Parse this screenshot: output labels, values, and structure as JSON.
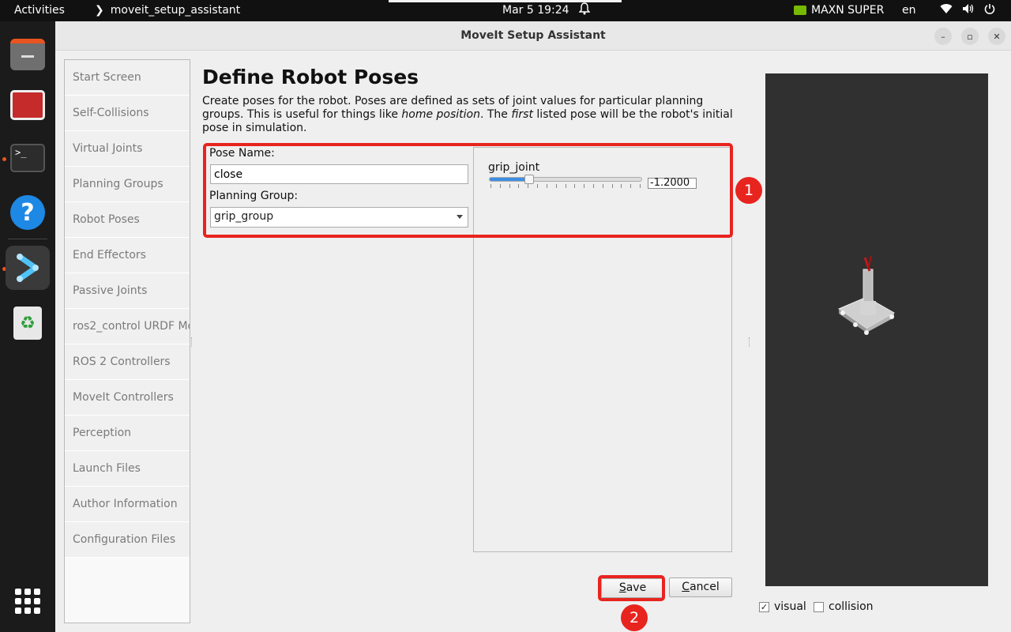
{
  "topbar": {
    "activities": "Activities",
    "app_name": "moveit_setup_assistant",
    "datetime": "Mar 5  19:24",
    "gpu_label": "MAXN SUPER",
    "language": "en"
  },
  "window": {
    "title": "MoveIt Setup Assistant"
  },
  "sidebar": {
    "items": [
      {
        "label": "Start Screen"
      },
      {
        "label": "Self-Collisions"
      },
      {
        "label": "Virtual Joints"
      },
      {
        "label": "Planning Groups"
      },
      {
        "label": "Robot Poses"
      },
      {
        "label": "End Effectors"
      },
      {
        "label": "Passive Joints"
      },
      {
        "label": "ros2_control URDF Mod"
      },
      {
        "label": "ROS 2 Controllers"
      },
      {
        "label": "MoveIt Controllers"
      },
      {
        "label": "Perception"
      },
      {
        "label": "Launch Files"
      },
      {
        "label": "Author Information"
      },
      {
        "label": "Configuration Files"
      }
    ]
  },
  "main": {
    "heading": "Define Robot Poses",
    "desc_part1": "Create poses for the robot. Poses are defined as sets of joint values for particular planning groups. This is useful for things like ",
    "desc_em1": "home position",
    "desc_part2": ". The ",
    "desc_em2": "first",
    "desc_part3": " listed pose will be the robot's initial pose in simulation.",
    "pose_name_label": "Pose Name:",
    "pose_name_value": "close",
    "planning_group_label": "Planning Group:",
    "planning_group_value": "grip_group",
    "joint": {
      "name": "grip_joint",
      "value_text": "-1.2000",
      "slider_fraction": 0.26
    },
    "save_prefix": "",
    "save_underlined": "S",
    "save_rest": "ave",
    "cancel_underlined": "C",
    "cancel_rest": "ancel"
  },
  "annotations": {
    "badge1": "1",
    "badge2": "2",
    "color": "#e8241f"
  },
  "preview": {
    "visual_label": "visual",
    "visual_checked": true,
    "collision_label": "collision",
    "collision_checked": false
  }
}
